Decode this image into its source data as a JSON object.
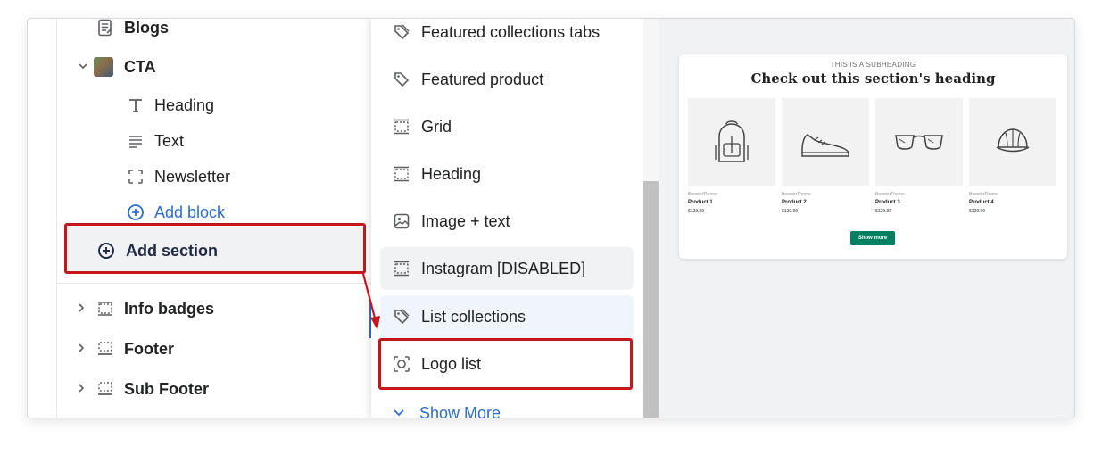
{
  "sidebar": {
    "blogs_label": "Blogs",
    "cta_label": "CTA",
    "cta_blocks": [
      {
        "label": "Heading",
        "icon": "text-t-icon"
      },
      {
        "label": "Text",
        "icon": "text-lines-icon"
      },
      {
        "label": "Newsletter",
        "icon": "dashed-square-icon"
      }
    ],
    "add_block_label": "Add block",
    "add_section_label": "Add section",
    "sections": [
      {
        "label": "Info badges"
      },
      {
        "label": "Footer"
      },
      {
        "label": "Sub Footer"
      }
    ]
  },
  "picker": {
    "items": [
      {
        "label": "Featured collections tabs",
        "icon": "tag-icon"
      },
      {
        "label": "Featured product",
        "icon": "tag-icon"
      },
      {
        "label": "Grid",
        "icon": "section-icon"
      },
      {
        "label": "Heading",
        "icon": "section-icon"
      },
      {
        "label": "Image + text",
        "icon": "image-icon"
      },
      {
        "label": "Instagram [DISABLED]",
        "icon": "section-icon"
      },
      {
        "label": "List collections",
        "icon": "tag-icon"
      },
      {
        "label": "Logo list",
        "icon": "logo-icon"
      }
    ],
    "show_more_label": "Show More"
  },
  "preview": {
    "subheading": "THIS IS A SUBHEADING",
    "heading": "Check out this section's heading",
    "products": [
      {
        "vendor": "BoosterTheme",
        "name": "Product 1",
        "price": "$129.99",
        "image": "backpack-icon"
      },
      {
        "vendor": "BoosterTheme",
        "name": "Product 2",
        "price": "$129.99",
        "image": "sneaker-icon"
      },
      {
        "vendor": "BoosterTheme",
        "name": "Product 3",
        "price": "$129.99",
        "image": "sunglasses-icon"
      },
      {
        "vendor": "BoosterTheme",
        "name": "Product 4",
        "price": "$129.99",
        "image": "cap-icon"
      }
    ],
    "button_label": "Show more"
  },
  "colors": {
    "highlight": "#c5161d",
    "link": "#2c6ecb",
    "button": "#008060"
  }
}
